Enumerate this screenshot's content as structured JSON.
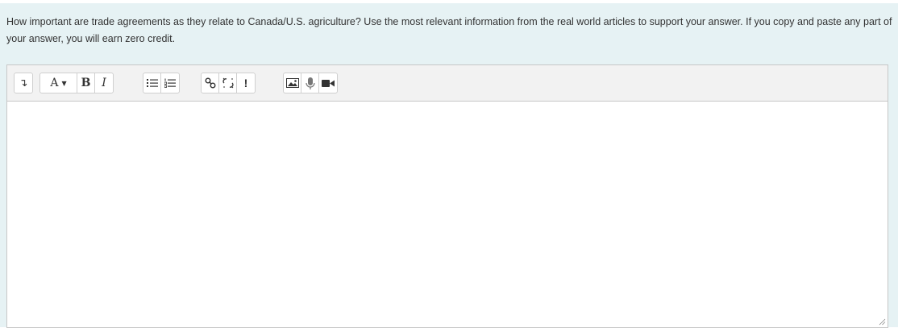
{
  "question": {
    "text": "How important are trade agreements as they relate to Canada/U.S. agriculture? Use the most relevant information from the real world articles to support your answer.  If you copy and paste any part of your answer, you will earn zero credit."
  },
  "toolbar": {
    "show_more_glyph": "↴",
    "paragraph_style_label": "A",
    "paragraph_style_caret": "▼",
    "bold_label": "B",
    "italic_label": "I",
    "accessibility_checker_label": "!"
  },
  "icons": {
    "show_more": "show-more-icon",
    "unordered_list": "unordered-list-icon",
    "ordered_list": "ordered-list-icon",
    "link": "link-icon",
    "unlink": "unlink-icon",
    "image": "image-icon",
    "record_audio": "microphone-icon",
    "record_video": "video-camera-icon"
  },
  "editor": {
    "content": ""
  },
  "colors": {
    "panel_background": "#e6f2f4",
    "toolbar_background": "#f2f2f2",
    "border": "#c7c7c7",
    "text": "#333333"
  }
}
